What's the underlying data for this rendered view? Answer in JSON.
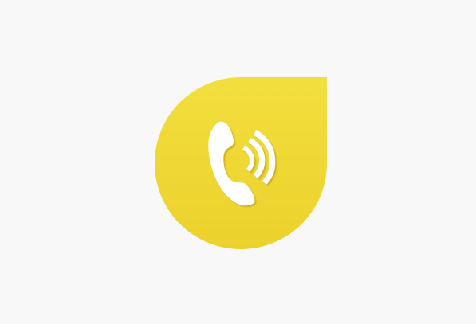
{
  "app_icon": {
    "name": "phone-call-app-icon",
    "glyph": "phone-ringing-icon",
    "colors": {
      "background": "#f8f8f8",
      "tile_top": "#f2df3d",
      "tile_bottom": "#ecd12c",
      "glyph": "#ffffff",
      "glyph_shadow": "#c9ad1c"
    }
  }
}
